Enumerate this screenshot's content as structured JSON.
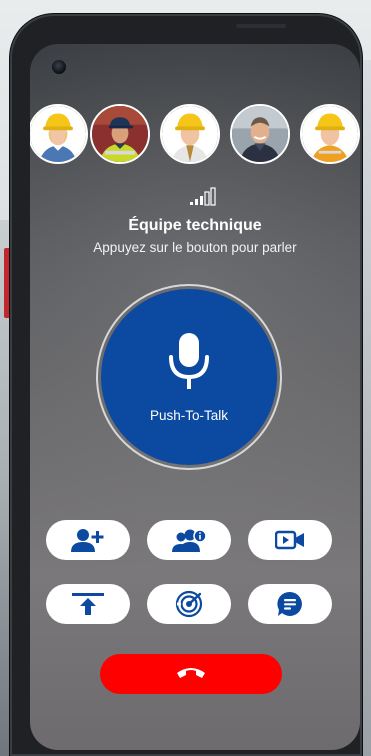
{
  "group": {
    "name": "Équipe technique",
    "instruction": "Appuyez sur le bouton pour parler"
  },
  "ptt": {
    "label": "Push-To-Talk",
    "icon": "microphone-icon"
  },
  "participants": [
    {
      "avatar": "worker-yellow-helmet-woman"
    },
    {
      "avatar": "worker-blue-cap-hivis"
    },
    {
      "avatar": "worker-yellow-helmet-man"
    },
    {
      "avatar": "worker-smiling-man"
    },
    {
      "avatar": "worker-yellow-helmet-man-2"
    }
  ],
  "actions": [
    {
      "icon": "add-user-icon"
    },
    {
      "icon": "group-info-icon"
    },
    {
      "icon": "video-camera-icon"
    },
    {
      "icon": "upload-icon"
    },
    {
      "icon": "radar-icon"
    },
    {
      "icon": "chat-icon"
    }
  ],
  "hangup": {
    "icon": "phone-hangup-icon"
  },
  "colors": {
    "ptt_blue": "#0b4aa0",
    "icon_blue": "#0b4aa0",
    "hangup_red": "#ff0000"
  }
}
